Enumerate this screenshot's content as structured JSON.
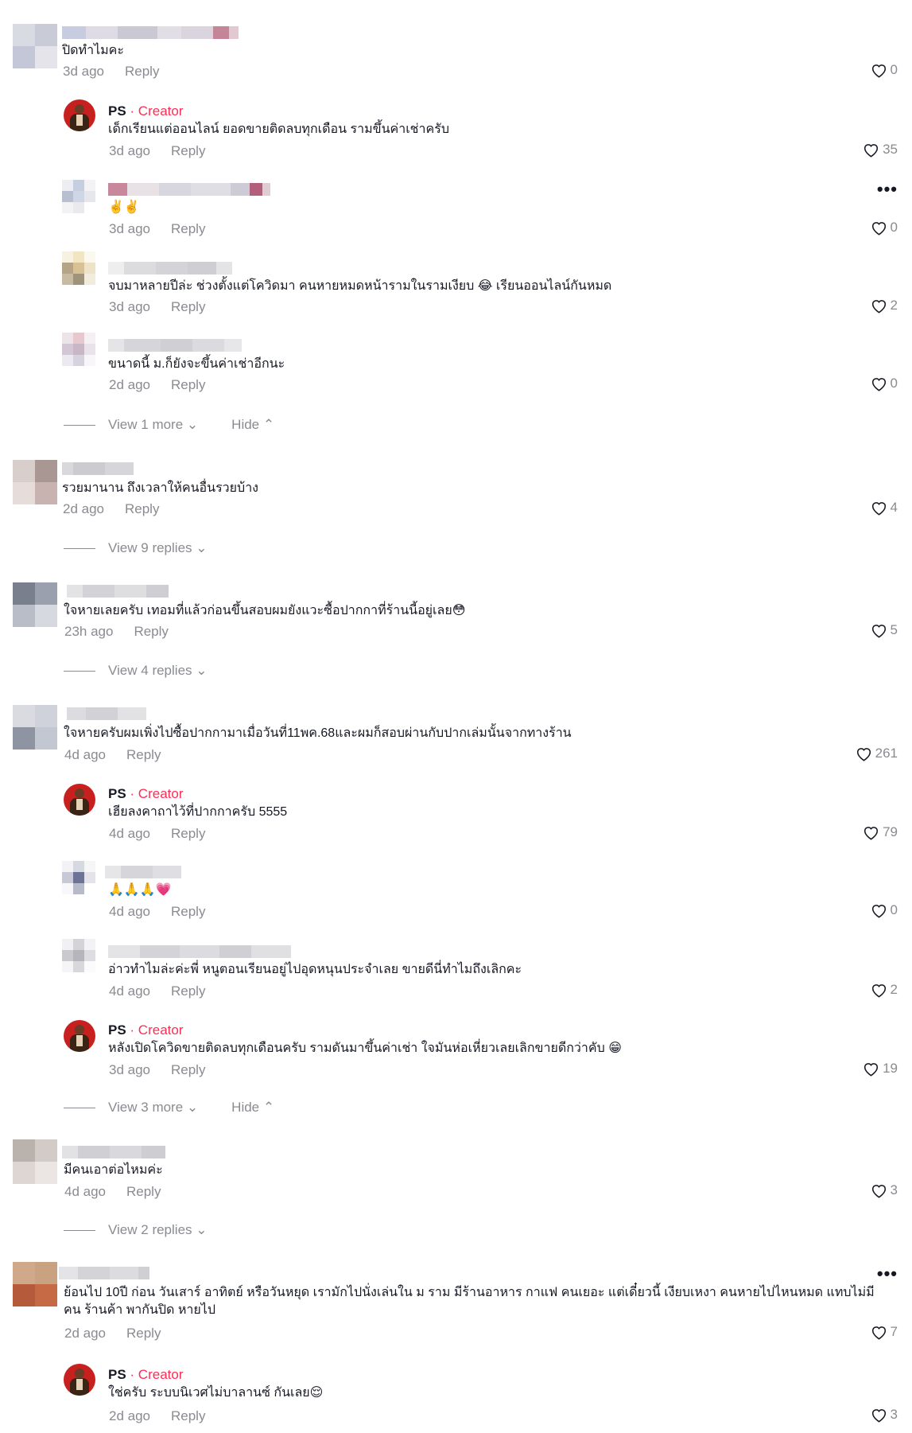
{
  "labels": {
    "reply": "Reply",
    "creator_badge": "Creator",
    "hide": "Hide",
    "more": "•••"
  },
  "comments": [
    {
      "text": "ปิดทำไมคะ",
      "time": "3d ago",
      "likes": "0"
    },
    {
      "creator": "PS",
      "text": "เด็กเรียนแต่ออนไลน์ ยอดขายติดลบทุกเดือน รามขึ้นค่าเช่าครับ",
      "time": "3d ago",
      "likes": "35"
    },
    {
      "text": "✌️✌️",
      "time": "3d ago",
      "likes": "0"
    },
    {
      "text": "จบมาหลายปีล่ะ ช่วงตั้งแต่โควิดมา คนหายหมดหน้ารามในรามเงียบ 😂 เรียนออนไลน์กันหมด",
      "time": "3d ago",
      "likes": "2"
    },
    {
      "text": "ขนาดนี้ ม.ก็ยังจะขึ้นค่าเช่าอีกนะ",
      "time": "2d ago",
      "likes": "0"
    },
    {
      "text": "รวยมานาน ถึงเวลาให้คนอื่นรวยบ้าง",
      "time": "2d ago",
      "likes": "4"
    },
    {
      "text": "ใจหายเลยครับ เทอมที่แล้วก่อนขึ้นสอบผมยังแวะซื้อปากกาที่ร้านนี้อยู่เลย😳",
      "time": "23h ago",
      "likes": "5"
    },
    {
      "text": "ใจหายครับผมเพิ่งไปซื้อปากกามาเมื่อวันที่11พค.68และผมก็สอบผ่านกับปากเล่มนั้นจากทางร้าน",
      "time": "4d ago",
      "likes": "261"
    },
    {
      "creator": "PS",
      "text": "เฮียลงคาถาไว้ที่ปากกาครับ 5555",
      "time": "4d ago",
      "likes": "79"
    },
    {
      "text": "🙏🙏🙏💗",
      "time": "4d ago",
      "likes": "0"
    },
    {
      "text": "อ่าวทำไมล่ะค่ะพี่ หนูตอนเรียนอยู่ไปอุดหนุนประจำเลย ขายดีนี่ทำไมถึงเลิกคะ",
      "time": "4d ago",
      "likes": "2"
    },
    {
      "creator": "PS",
      "text": "หลังเปิดโควิดขายติดลบทุกเดือนครับ รามดันมาขึ้นค่าเช่า ใจมันห่อเหี่ยวเลยเลิกขายดีกว่าคับ 😁",
      "time": "3d ago",
      "likes": "19"
    },
    {
      "text": "มีคนเอาต่อไหมค่ะ",
      "time": "4d ago",
      "likes": "3"
    },
    {
      "text": "ย้อนไป 10ปี ก่อน วันเสาร์ อาทิตย์ หรือวันหยุด เรามักไปนั่งเล่นใน ม ราม มีร้านอาหาร กาแฟ คนเยอะ แต่เดี๋ยวนี้ เงียบเหงา คนหายไปไหนหมด แทบไม่มีคน ร้านค้า พากันปิด หายไป",
      "time": "2d ago",
      "likes": "7"
    },
    {
      "creator": "PS",
      "text": "ใช่ครับ ระบบนิเวศไม่บาลานซ์ กันเลย😌",
      "time": "2d ago",
      "likes": "3"
    }
  ],
  "views": [
    {
      "label": "View 1 more"
    },
    {
      "label": "View 9 replies"
    },
    {
      "label": "View 4 replies"
    },
    {
      "label": "View 3 more"
    },
    {
      "label": "View 2 replies"
    }
  ],
  "colors": {
    "accent": "#fe2c55",
    "muted": "#8a8b91",
    "text": "#161823"
  },
  "icons": {
    "like": "heart-outline-icon",
    "expand": "chevron-down-icon",
    "collapse": "chevron-up-icon",
    "menu": "more-horizontal-icon"
  }
}
